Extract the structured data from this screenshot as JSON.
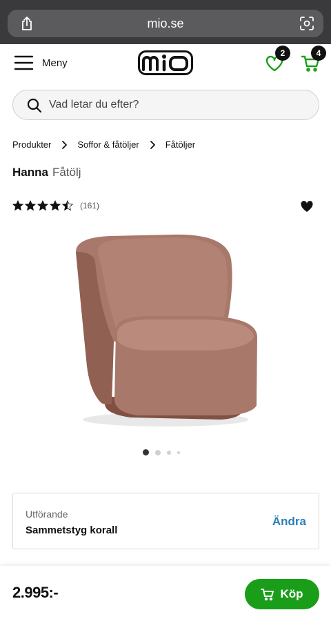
{
  "browser": {
    "url": "mio.se"
  },
  "header": {
    "menu_label": "Meny",
    "logo_text": "miO",
    "wishlist_count": "2",
    "cart_count": "4"
  },
  "search": {
    "placeholder": "Vad letar du efter?"
  },
  "breadcrumb": [
    {
      "label": "Produkter"
    },
    {
      "label": "Soffor & fåtöljer"
    },
    {
      "label": "Fåtöljer"
    }
  ],
  "product": {
    "name": "Hanna",
    "category": "Fåtölj",
    "rating": 4.5,
    "review_count": "(161)",
    "image_count": 4,
    "active_image": 1,
    "chair_color": "#a8786b"
  },
  "variant": {
    "label": "Utförande",
    "value": "Sammetstyg korall",
    "change_label": "Ändra"
  },
  "purchase": {
    "price": "2.995:-",
    "buy_label": "Köp"
  },
  "colors": {
    "brand_green": "#1a9e1a",
    "link_blue": "#2a7fb5"
  },
  "icons": [
    "share-icon",
    "lens-icon",
    "hamburger-icon",
    "heart-outline-icon",
    "cart-icon",
    "search-icon",
    "chevron-right-icon",
    "star-icon",
    "heart-filled-icon"
  ]
}
